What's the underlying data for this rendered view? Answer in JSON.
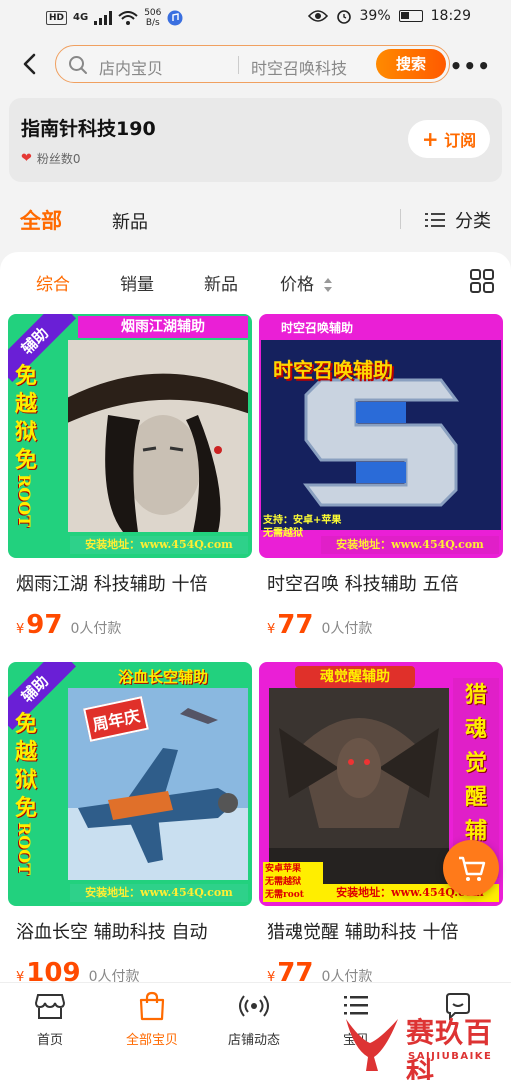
{
  "status_bar": {
    "hd": "HD",
    "signal": "4G",
    "net_speed_value": "506",
    "net_speed_unit": "B/s",
    "battery": "39%",
    "time": "18:29"
  },
  "search": {
    "scope": "店内宝贝",
    "query": "时空召唤科技",
    "button": "搜索"
  },
  "shop": {
    "name": "指南针科技190",
    "fans": "粉丝数0",
    "subscribe": "订阅"
  },
  "category_tabs": {
    "all": "全部",
    "new": "新品",
    "classify": "分类"
  },
  "sort_bar": {
    "items": [
      "综合",
      "销量",
      "新品",
      "价格"
    ],
    "active": "综合"
  },
  "products": [
    {
      "title": "烟雨江湖 科技辅助 十倍",
      "currency": "¥",
      "price": "97",
      "sold": "0人付款",
      "art_banner": "烟雨江湖辅助",
      "art_side": [
        "免",
        "越",
        "狱",
        "免",
        "ROOT"
      ],
      "art_corner": "辅助",
      "art_address": "安装地址：www.454Q.com"
    },
    {
      "title": "时空召唤 科技辅助 五倍",
      "currency": "¥",
      "price": "77",
      "sold": "0人付款",
      "art_banner": "时空召唤辅助",
      "art_headline": "时空召唤辅助",
      "art_support": "支持：安卓+苹果",
      "art_noroot": "无需越狱",
      "art_address": "安装地址：www.454Q.com"
    },
    {
      "title": "浴血长空 辅助科技 自动",
      "currency": "¥",
      "price": "109",
      "sold": "0人付款",
      "art_banner": "浴血长空辅助",
      "art_side": [
        "免",
        "越",
        "狱",
        "免",
        "ROOT"
      ],
      "art_corner": "辅助",
      "art_badge": "周年庆",
      "art_address": "安装地址：www.454Q.com"
    },
    {
      "title": "猎魂觉醒 辅助科技 十倍",
      "currency": "¥",
      "price": "77",
      "sold": "0人付款",
      "art_banner": "魂觉醒辅助",
      "art_side": [
        "猎",
        "魂",
        "觉",
        "醒",
        "辅"
      ],
      "art_stamp": [
        "安卓苹果",
        "无需越狱",
        "无需root"
      ],
      "art_address": "安装地址：www.454Q.com"
    }
  ],
  "bottom_nav": [
    {
      "label": "首页",
      "icon": "store-icon"
    },
    {
      "label": "全部宝贝",
      "icon": "shopping-bag-icon"
    },
    {
      "label": "店铺动态",
      "icon": "broadcast-icon"
    },
    {
      "label": "宝贝",
      "icon": "category-list-icon"
    },
    {
      "label": "",
      "icon": "chat-icon"
    }
  ],
  "watermark": {
    "cn": "赛玖百科",
    "en": "SAIJIUBAIKE"
  },
  "colors": {
    "accent": "#ff6a00",
    "price": "#ff4a00",
    "banner_green": "#22d17e",
    "banner_magenta": "#ea1fd6"
  }
}
